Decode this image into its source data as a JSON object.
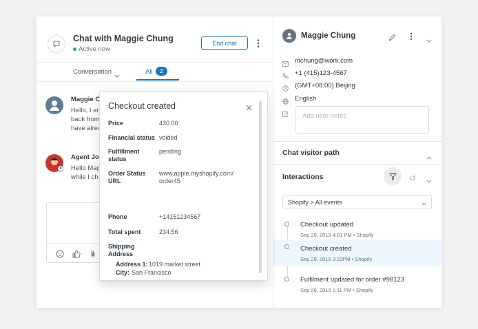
{
  "chat": {
    "title": "Chat with Maggie Chung",
    "status": "Active now",
    "end_chat_label": "End chat",
    "tabs": {
      "conversation": "Conversation",
      "all": "All",
      "all_count": "2"
    },
    "messages": [
      {
        "name": "Maggie C",
        "lines": [
          "Hello, I em",
          "back from",
          "have alrea"
        ]
      },
      {
        "name": "Agent Jol",
        "lines": [
          "Hello Mag",
          "while I ch"
        ]
      }
    ]
  },
  "popup": {
    "title": "Checkout created",
    "fields": [
      {
        "label": "Price",
        "value": "430.00"
      },
      {
        "label": "Financial status",
        "value": "voided"
      },
      {
        "label": "Fulfillment status",
        "value": "pending"
      },
      {
        "label": "Order Status URL",
        "value": "www.apple.myshopify.com/ order45"
      },
      {
        "label": "Phone",
        "value": "+14151234567"
      },
      {
        "label": "Total spent",
        "value": "234.56"
      }
    ],
    "shipping_label": "Shipping Address",
    "address": [
      {
        "label": "Address 1:",
        "value": "1019 market street"
      },
      {
        "label": "City:",
        "value": "San Francisco"
      }
    ]
  },
  "user": {
    "name": "Maggie Chung",
    "email": "mchung@work.com",
    "phone": "+1 (415)123-4567",
    "timezone": "(GMT+08:00) Beijing",
    "language": "English",
    "notes_placeholder": "Add user notes"
  },
  "sections": {
    "visitor_path": "Chat visitor path",
    "interactions": "Interactions",
    "filter_value": "Shopify > All events"
  },
  "events": [
    {
      "title": "Checkout updated",
      "sub": "Sep 29, 2019 4:01 PM • Shopify",
      "highlighted": false
    },
    {
      "title": "Checkout created",
      "sub": "Sep 29, 2019 3:23PM • Shopify",
      "highlighted": true
    },
    {
      "title": "Fulfilment updated for order #98123",
      "sub": "Sep 26, 2019 1:11 PM • Shopify",
      "highlighted": false
    }
  ],
  "colors": {
    "accent": "#1f73b7",
    "online": "#2ea572",
    "highlight": "#edf7ff"
  }
}
